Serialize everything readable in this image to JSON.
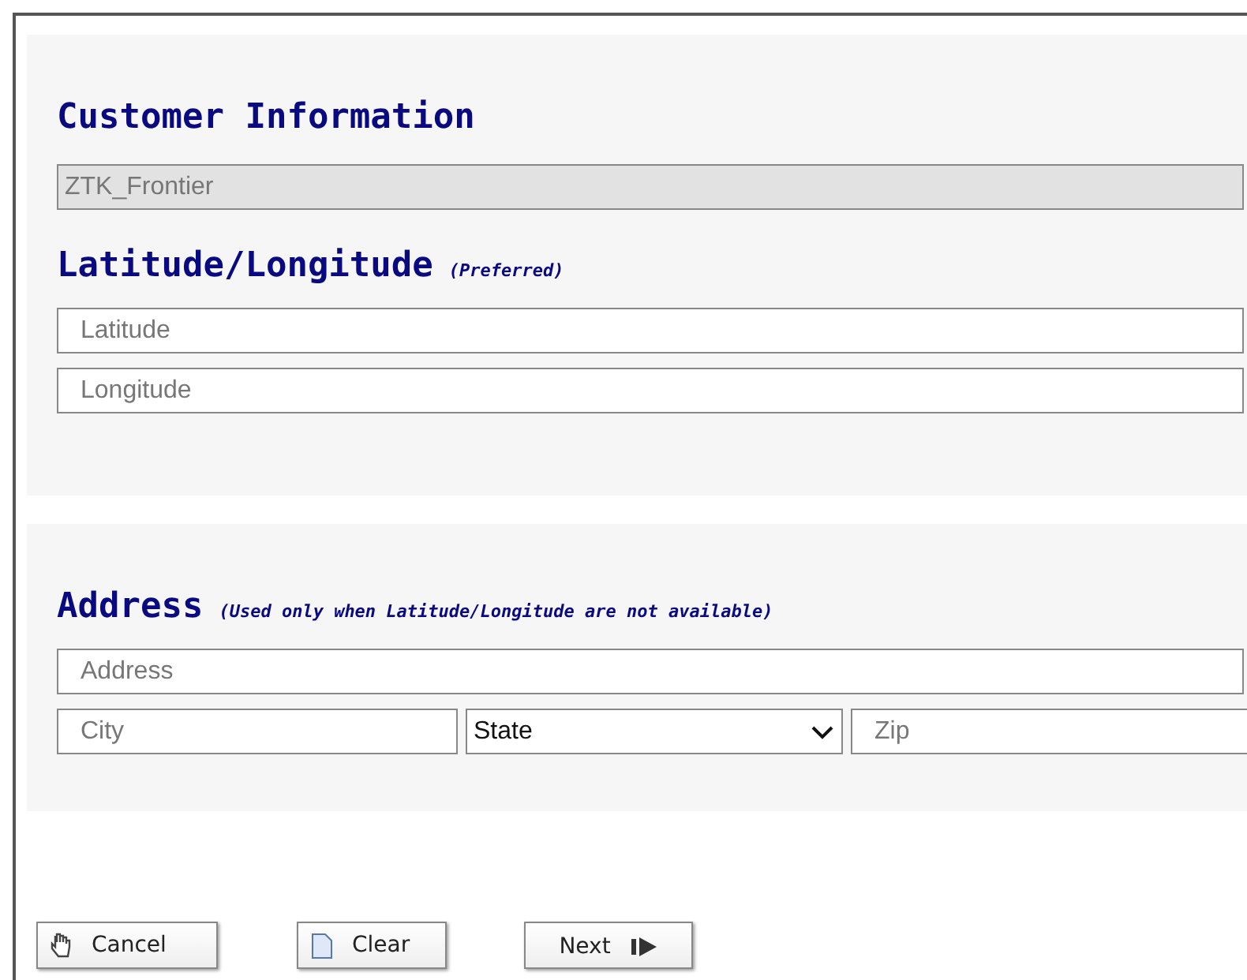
{
  "customer_section": {
    "title": "Customer Information",
    "company_field": {
      "value": "ZTK_Frontier",
      "disabled": true
    },
    "coordinates_heading": "Latitude/Longitude",
    "coordinates_note": "(Preferred)",
    "fields": [
      {
        "placeholder": "Latitude"
      },
      {
        "placeholder": "Longitude"
      }
    ]
  },
  "address_section": {
    "heading": "Address",
    "note": "(Used only when Latitude/Longitude are not available)",
    "address_field": {
      "placeholder": "Address"
    },
    "city_field": {
      "placeholder": "City"
    },
    "state_select": {
      "value": "State"
    },
    "zip_field": {
      "placeholder": "Zip"
    }
  },
  "buttons": [
    {
      "label": "Cancel",
      "kind": "cancel"
    },
    {
      "label": "Clear",
      "kind": "clear"
    },
    {
      "label": "Next",
      "kind": "next"
    }
  ]
}
